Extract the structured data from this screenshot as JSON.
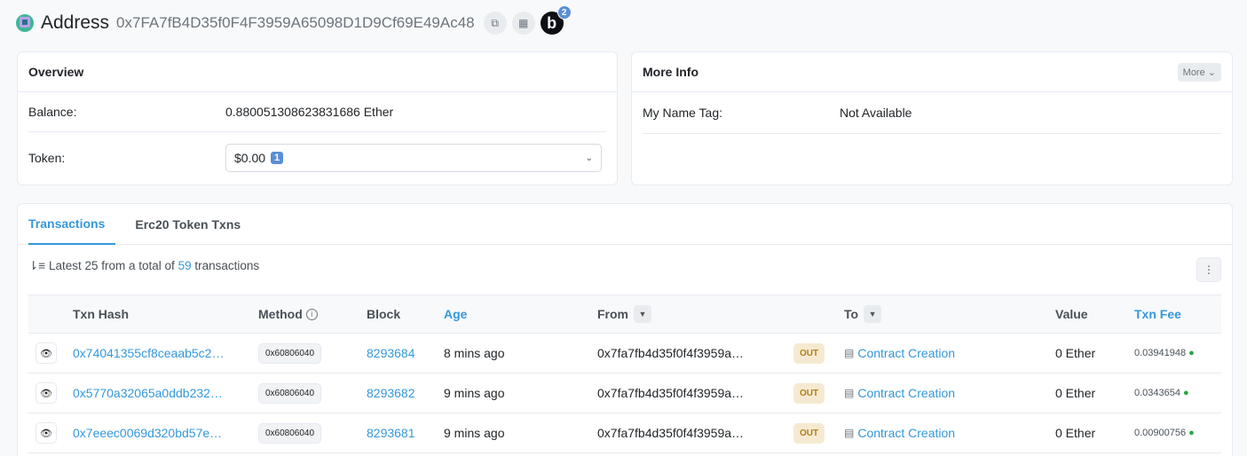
{
  "header": {
    "title": "Address",
    "address": "0x7FA7fB4D35f0F4F3959A65098D1D9Cf69E49Ac48",
    "blockscan_letter": "b",
    "blockscan_count": "2"
  },
  "overview": {
    "title": "Overview",
    "balance_label": "Balance:",
    "balance_value": "0.880051308623831686 Ether",
    "token_label": "Token:",
    "token_value": "$0.00",
    "token_count": "1"
  },
  "more_info": {
    "title": "More Info",
    "more_button": "More",
    "name_tag_label": "My Name Tag:",
    "name_tag_value": "Not Available"
  },
  "tabs": [
    {
      "label": "Transactions",
      "active": true
    },
    {
      "label": "Erc20 Token Txns",
      "active": false
    }
  ],
  "summary": {
    "prefix": "Latest 25 from a total of",
    "count": "59",
    "suffix": "transactions"
  },
  "table": {
    "headers": {
      "txn_hash": "Txn Hash",
      "method": "Method",
      "block": "Block",
      "age": "Age",
      "from": "From",
      "to": "To",
      "value": "Value",
      "txn_fee": "Txn Fee"
    },
    "rows": [
      {
        "hash": "0x74041355cf8ceaab5c2…",
        "method": "0x60806040",
        "block": "8293684",
        "age": "8 mins ago",
        "from": "0x7fa7fb4d35f0f4f3959a…",
        "direction": "OUT",
        "to": "Contract Creation",
        "value": "0 Ether",
        "fee": "0.03941948"
      },
      {
        "hash": "0x5770a32065a0ddb232…",
        "method": "0x60806040",
        "block": "8293682",
        "age": "9 mins ago",
        "from": "0x7fa7fb4d35f0f4f3959a…",
        "direction": "OUT",
        "to": "Contract Creation",
        "value": "0 Ether",
        "fee": "0.0343654"
      },
      {
        "hash": "0x7eeec0069d320bd57e…",
        "method": "0x60806040",
        "block": "8293681",
        "age": "9 mins ago",
        "from": "0x7fa7fb4d35f0f4f3959a…",
        "direction": "OUT",
        "to": "Contract Creation",
        "value": "0 Ether",
        "fee": "0.00900756"
      }
    ]
  },
  "colors": {
    "link": "#3498db",
    "out_badge_bg": "#f5ead1",
    "out_badge_text": "#b07d14"
  }
}
